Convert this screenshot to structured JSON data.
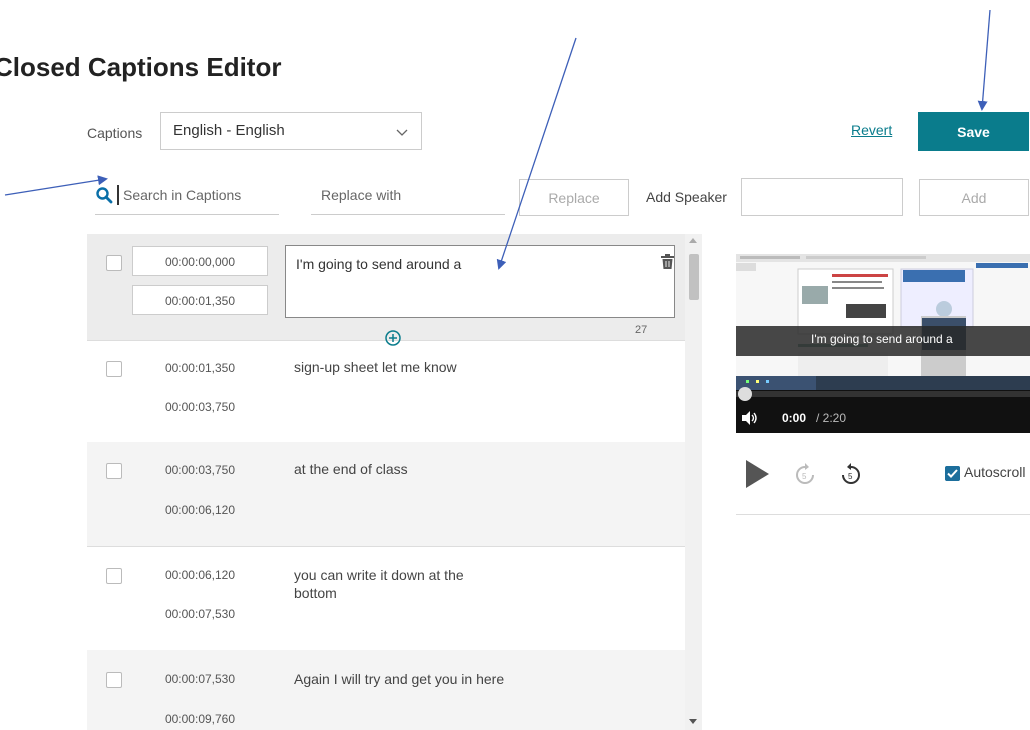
{
  "page_title": "Closed Captions Editor",
  "captions": {
    "label": "Captions",
    "selected_language": "English - English"
  },
  "actions": {
    "revert_label": "Revert",
    "save_label": "Save"
  },
  "search": {
    "placeholder": "Search in Captions"
  },
  "replace": {
    "placeholder": "Replace with",
    "button_label": "Replace"
  },
  "speaker": {
    "label": "Add Speaker",
    "button_label": "Add"
  },
  "caption_rows": [
    {
      "start": "00:00:00,000",
      "end": "00:00:01,350",
      "text": "I'm going to send around a",
      "char_count": "27"
    },
    {
      "start": "00:00:01,350",
      "end": "00:00:03,750",
      "text": "sign-up sheet let me know"
    },
    {
      "start": "00:00:03,750",
      "end": "00:00:06,120",
      "text": "at the end of class"
    },
    {
      "start": "00:00:06,120",
      "end": "00:00:07,530",
      "text": "you can write  it down at the bottom"
    },
    {
      "start": "00:00:07,530",
      "end": "00:00:09,760",
      "text": "Again I will try and get you in here"
    }
  ],
  "video": {
    "caption_overlay": "I'm going to send around a",
    "current_time": "0:00",
    "total_time": "/ 2:20",
    "progress_fraction": 0
  },
  "player": {
    "autoscroll_label": "Autoscroll",
    "autoscroll_checked": true
  },
  "colors": {
    "accent": "#0a7c8c",
    "annotation_arrow": "#3d5fb8",
    "checkbox_checked": "#1c6e9c"
  }
}
